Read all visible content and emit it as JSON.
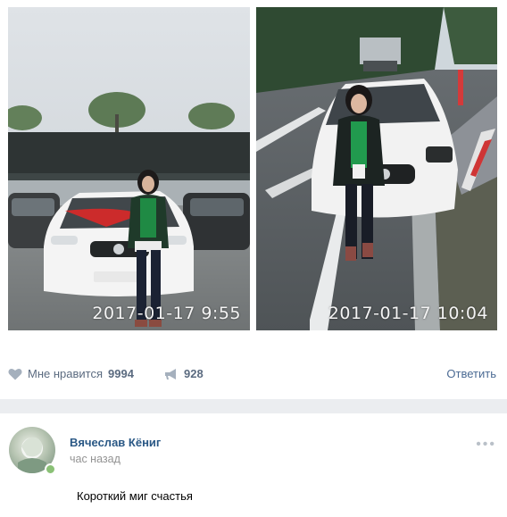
{
  "photos": [
    {
      "timestamp": "2017-01-17  9:55"
    },
    {
      "timestamp": "2017-01-17  10:04"
    }
  ],
  "actions": {
    "like_label": "Мне нравится",
    "like_count": "9994",
    "share_count": "928",
    "reply_label": "Ответить"
  },
  "comment": {
    "author": "Вячеслав Кёниг",
    "time": "час назад",
    "text": "Короткий миг счастья"
  },
  "icons": {
    "like": "heart-icon",
    "share": "megaphone-icon",
    "more": "more-dots-icon"
  },
  "colors": {
    "link_blue": "#2a5885",
    "muted": "#939393",
    "separator": "#ebedf0"
  }
}
